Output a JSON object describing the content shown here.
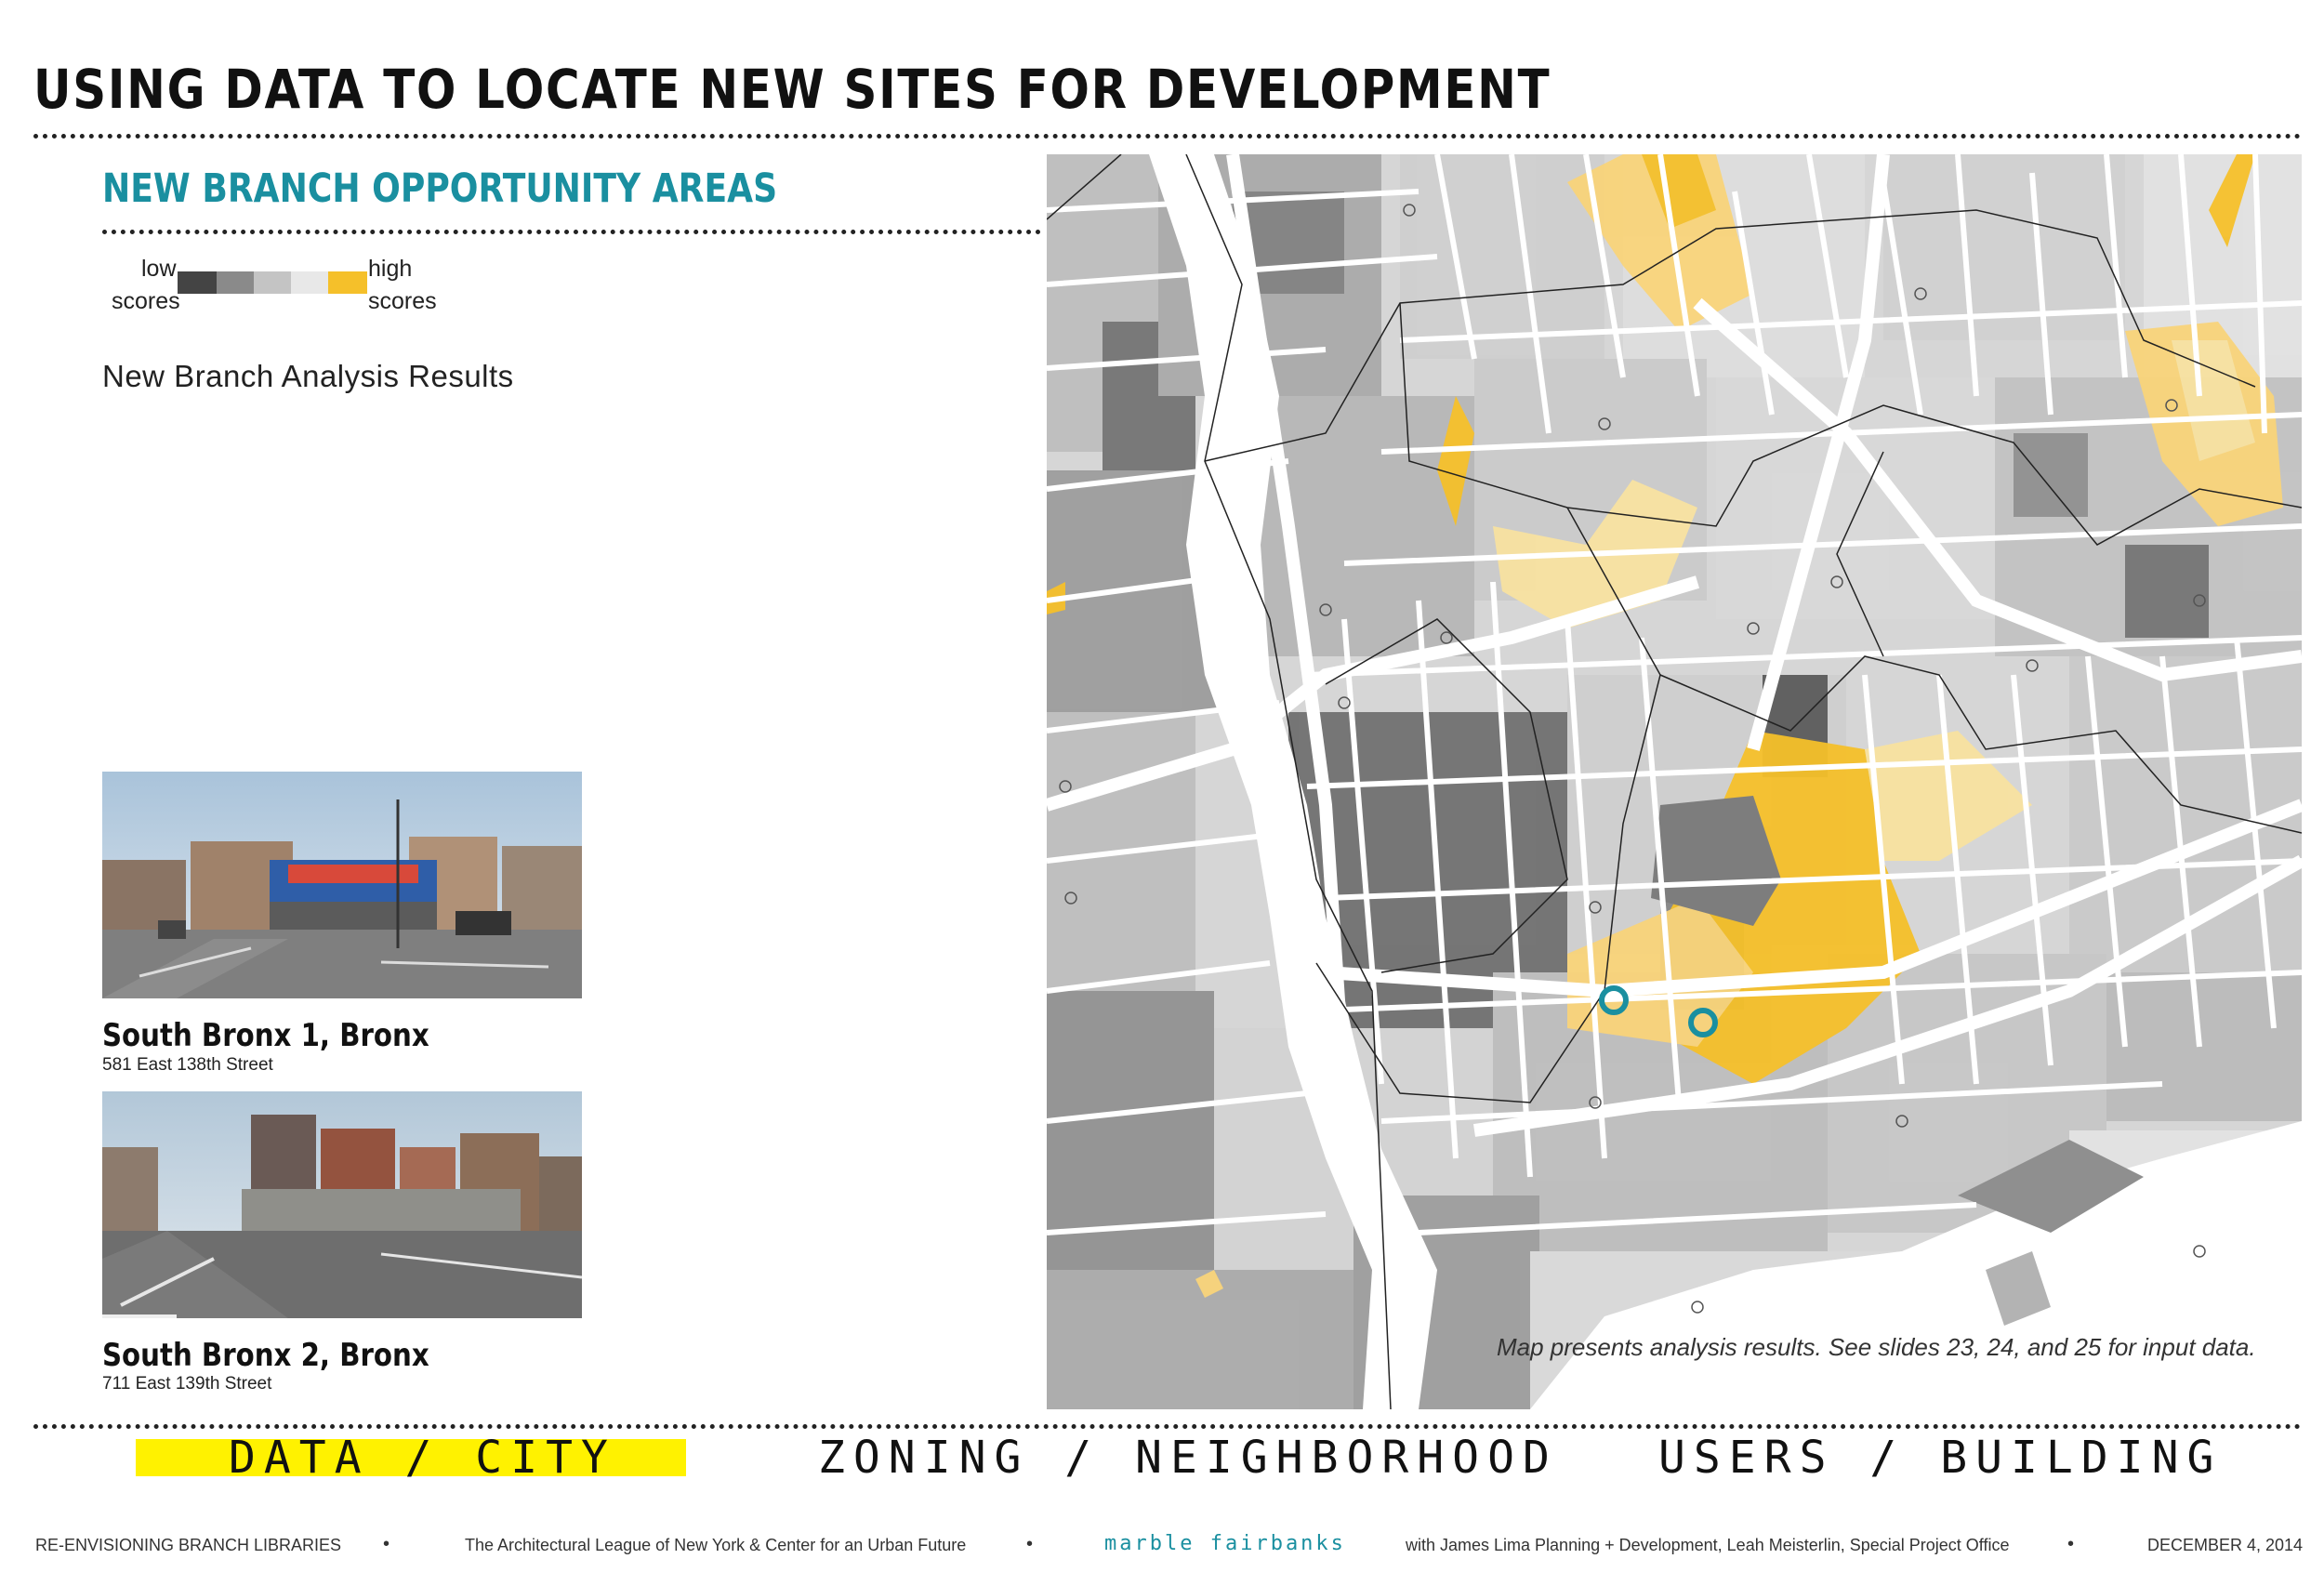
{
  "header": {
    "title": "USING DATA TO LOCATE NEW SITES FOR DEVELOPMENT"
  },
  "section": {
    "title": "NEW BRANCH OPPORTUNITY AREAS",
    "analysis_label": "New Branch Analysis Results"
  },
  "legend": {
    "low_label_1": "low",
    "low_label_2": "scores",
    "high_label_1": "high",
    "high_label_2": "scores",
    "swatches": [
      "#444444",
      "#8a8a8a",
      "#c4c4c4",
      "#e8e8e8",
      "#f8e2a0",
      "#f9d47a",
      "#f5c02a"
    ]
  },
  "sites": [
    {
      "name": "South Bronx 1, Bronx",
      "address": "581 East 138th Street"
    },
    {
      "name": "South Bronx 2, Bronx",
      "address": "711 East 139th Street"
    }
  ],
  "map": {
    "caption": "Map presents analysis results. See slides 23, 24, and 25 for input data.",
    "marker_color": "#1a8fa0",
    "highlight_color": "#f5c02a"
  },
  "nav": {
    "item_1": "DATA / CITY",
    "item_2": "ZONING / NEIGHBORHOOD",
    "item_3": "USERS / BUILDING",
    "active_color": "#fff200"
  },
  "footer": {
    "project": "RE-ENVISIONING BRANCH LIBRARIES",
    "partners": "The Architectural League of New York & Center for an Urban Future",
    "brand": "marble fairbanks",
    "collaborators": "with James Lima Planning + Development, Leah Meisterlin, Special Project Office",
    "date": "DECEMBER 4, 2014",
    "separator": "•"
  }
}
